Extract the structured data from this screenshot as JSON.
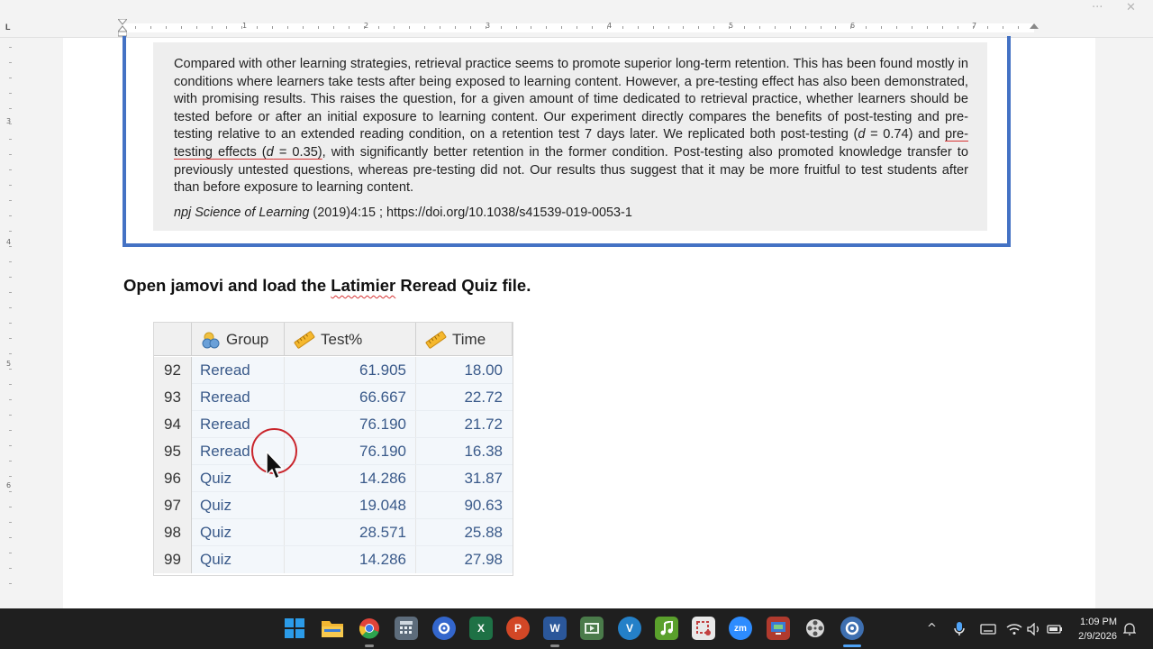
{
  "window": {
    "more_glyph": "···",
    "close_glyph": "✕"
  },
  "ruler": {
    "corner_label": "L",
    "numbers": [
      "1",
      "2",
      "3",
      "4",
      "5",
      "6",
      "7"
    ],
    "vertical_numbers": [
      "3",
      "4",
      "5",
      "6"
    ]
  },
  "document": {
    "abstract": {
      "line_part1": "Compared with other learning strategies, retrieval practice seems to promote superior long-term retention. This has been found mostly in conditions where learners take tests after being exposed to learning content. However, a pre-testing effect has also been demonstrated, with promising results. This raises the question, for a given amount of time dedicated to retrieval practice, whether learners should be tested before or after an initial exposure to learning content. Our experiment directly compares the benefits of post-testing and pre-testing relative to an extended reading condition, on a retention test 7 days later. We replicated both post-testing (",
      "d_symbol": "d",
      "post_effect": " = 0.74) and ",
      "pre_label": "pre-testing effects (",
      "pre_effect": " = 0.35)",
      "line_part2": ", with significantly better retention in the former condition. Post-testing also promoted knowledge transfer to previously untested questions, whereas pre-testing did not. Our results thus suggest that it may be more fruitful to test students after than before exposure to learning content."
    },
    "citation": {
      "journal": "npj Science of Learning",
      "details": " (2019)4:15 ; https://doi.org/10.1038/s41539-019-0053-1"
    },
    "instruction": {
      "before": "Open jamovi and load the ",
      "flagged_word": "Latimier",
      "after": " Reread Quiz file."
    }
  },
  "jamovi_table": {
    "columns": [
      {
        "label": "Group",
        "icon": "nominal-variable-icon"
      },
      {
        "label": "Test%",
        "icon": "continuous-ruler-icon"
      },
      {
        "label": "Time",
        "icon": "continuous-ruler-icon"
      }
    ],
    "rows": [
      {
        "n": "92",
        "group": "Reread",
        "test": "61.905",
        "time": "18.00"
      },
      {
        "n": "93",
        "group": "Reread",
        "test": "66.667",
        "time": "22.72"
      },
      {
        "n": "94",
        "group": "Reread",
        "test": "76.190",
        "time": "21.72"
      },
      {
        "n": "95",
        "group": "Reread",
        "test": "76.190",
        "time": "16.38"
      },
      {
        "n": "96",
        "group": "Quiz",
        "test": "14.286",
        "time": "31.87"
      },
      {
        "n": "97",
        "group": "Quiz",
        "test": "19.048",
        "time": "90.63"
      },
      {
        "n": "98",
        "group": "Quiz",
        "test": "28.571",
        "time": "25.88"
      },
      {
        "n": "99",
        "group": "Quiz",
        "test": "14.286",
        "time": "27.98"
      }
    ]
  },
  "taskbar": {
    "apps": [
      {
        "name": "windows-start-icon",
        "label": "",
        "color": "#2b9be8"
      },
      {
        "name": "file-explorer-icon",
        "label": "",
        "color": "#f2b632"
      },
      {
        "name": "chrome-icon",
        "label": "",
        "color": "#e0443a"
      },
      {
        "name": "calculator-icon",
        "label": "",
        "color": "#5d6c7b"
      },
      {
        "name": "app-settings-icon",
        "label": "",
        "color": "#3366cc"
      },
      {
        "name": "excel-icon",
        "label": "X",
        "color": "#1e7145"
      },
      {
        "name": "powerpoint-icon",
        "label": "P",
        "color": "#d24726"
      },
      {
        "name": "word-icon",
        "label": "W",
        "color": "#2b579a"
      },
      {
        "name": "media-icon",
        "label": "",
        "color": "#4a7b4a"
      },
      {
        "name": "vimeo-icon",
        "label": "V",
        "color": "#2480c8"
      },
      {
        "name": "music-icon",
        "label": "",
        "color": "#5aa02c"
      },
      {
        "name": "snipping-icon",
        "label": "",
        "color": "#c24040"
      },
      {
        "name": "zoom-icon",
        "label": "zm",
        "color": "#2d8cff"
      },
      {
        "name": "screen-recorder-icon",
        "label": "",
        "color": "#b03a2e"
      },
      {
        "name": "film-reel-icon",
        "label": "",
        "color": "#666666"
      },
      {
        "name": "jamovi-icon",
        "label": "",
        "color": "#3e6fb0"
      }
    ],
    "tray": {
      "chevron": "^",
      "time": "1:09 PM",
      "date": "2/9/2026"
    }
  }
}
